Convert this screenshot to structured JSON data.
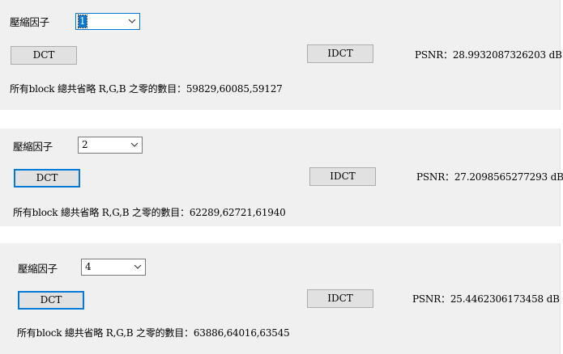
{
  "panels": [
    {
      "factor_label": "壓縮因子",
      "factor_value": "1",
      "dct_label": "DCT",
      "idct_label": "IDCT",
      "psnr_label": "PSNR：",
      "psnr_value": "28.9932087326203",
      "psnr_unit": "dB",
      "summary_label": "所有block 總共省略 R,G,B 之零的數目：",
      "summary_value": "59829,60085,59127"
    },
    {
      "factor_label": "壓縮因子",
      "factor_value": "2",
      "dct_label": "DCT",
      "idct_label": "IDCT",
      "psnr_label": "PSNR：",
      "psnr_value": "27.2098565277293",
      "psnr_unit": "dB",
      "summary_label": "所有block 總共省略 R,G,B 之零的數目：",
      "summary_value": "62289,62721,61940"
    },
    {
      "factor_label": "壓縮因子",
      "factor_value": "4",
      "dct_label": "DCT",
      "idct_label": "IDCT",
      "psnr_label": "PSNR：",
      "psnr_value": "25.4462306173458",
      "psnr_unit": "dB",
      "summary_label": "所有block 總共省略 R,G,B 之零的數目：",
      "summary_value": "63886,64016,63545"
    }
  ],
  "icons": {
    "dropdown": "chevron-down-icon"
  },
  "colors": {
    "panel_background": "#f0f0f0",
    "focus_accent": "#0078d7",
    "button_face": "#e1e1e1"
  }
}
